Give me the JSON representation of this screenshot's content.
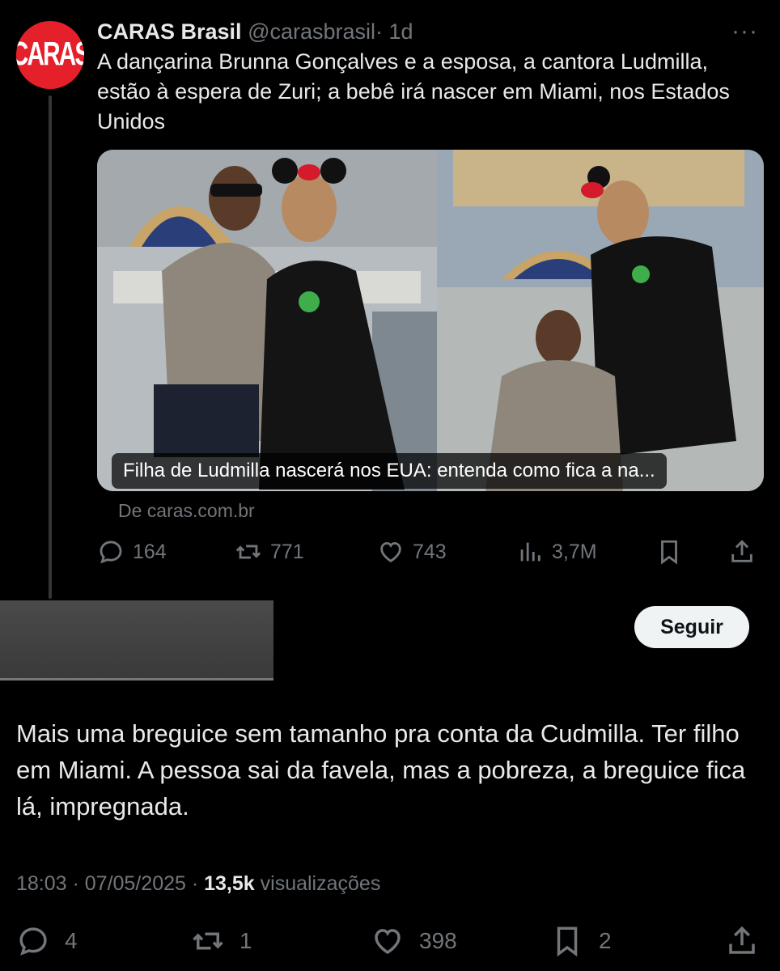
{
  "colors": {
    "background": "#000000",
    "text": "#e7e9ea",
    "muted": "#71767b",
    "brand": "#e5202b"
  },
  "quoted_tweet": {
    "avatar_text": "CARAS",
    "author_name": "CARAS Brasil",
    "handle": "@carasbrasil",
    "time": "· 1d",
    "more_icon": "more-horizontal-icon",
    "text": "A dançarina Brunna Gonçalves e a esposa, a cantora Ludmilla, estão à espera de Zuri; a bebê irá nascer em Miami, nos Estados Unidos",
    "card_caption": "Filha de Ludmilla nascerá nos EUA: entenda como fica a na...",
    "card_source": "De caras.com.br",
    "actions": {
      "replies": "164",
      "reposts": "771",
      "likes": "743",
      "views": "3,7M"
    }
  },
  "reply": {
    "follow_label": "Seguir",
    "text": "Mais uma breguice sem tamanho pra conta da Cudmilla. Ter filho em Miami. A pessoa sai da favela, mas a pobreza, a breguice fica lá, impregnada.",
    "timestamp": "18:03 · 07/05/2025 ·",
    "views_count": "13,5k",
    "views_label": "visualizações",
    "actions": {
      "replies": "4",
      "reposts": "1",
      "likes": "398",
      "bookmarks": "2"
    }
  }
}
